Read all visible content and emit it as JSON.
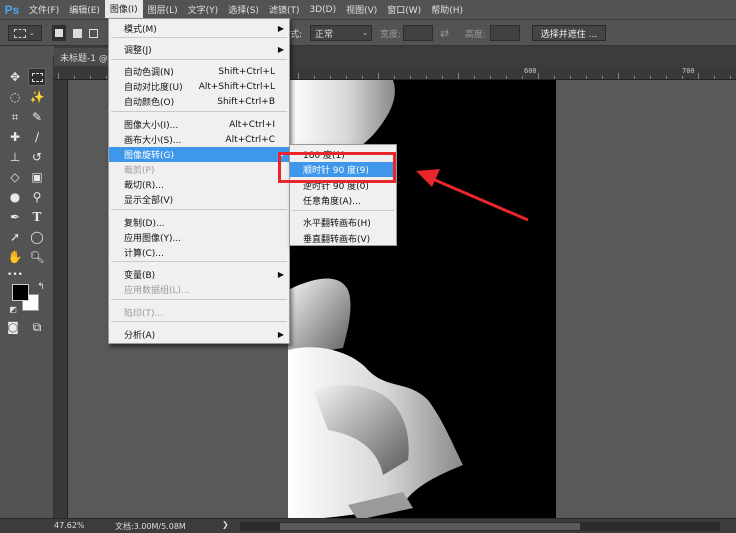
{
  "app": {
    "logo": "Ps"
  },
  "menubar": {
    "items": [
      {
        "label": "文件(F)",
        "active": false
      },
      {
        "label": "编辑(E)",
        "active": false
      },
      {
        "label": "图像(I)",
        "active": true
      },
      {
        "label": "图层(L)",
        "active": false
      },
      {
        "label": "文字(Y)",
        "active": false
      },
      {
        "label": "选择(S)",
        "active": false
      },
      {
        "label": "滤镜(T)",
        "active": false
      },
      {
        "label": "3D(D)",
        "active": false
      },
      {
        "label": "视图(V)",
        "active": false
      },
      {
        "label": "窗口(W)",
        "active": false
      },
      {
        "label": "帮助(H)",
        "active": false
      }
    ]
  },
  "options_bar": {
    "style_label": "式:",
    "style_value": "正常",
    "width_label": "宽度:",
    "height_label": "高度:",
    "select_mask_button": "选择并遮住 ..."
  },
  "document": {
    "tab_title": "未标题-1 @"
  },
  "ruler": {
    "labels": [
      "600",
      "700"
    ]
  },
  "status": {
    "zoom": "47.62%",
    "doc_info": "文档:3.00M/5.08M"
  },
  "image_menu": {
    "items": [
      {
        "label": "模式(M)",
        "shortcut": "",
        "submenu": true,
        "disabled": false,
        "highlighted": false
      },
      {
        "label": "调整(J)",
        "shortcut": "",
        "submenu": true,
        "disabled": false,
        "highlighted": false
      },
      {
        "label": "自动色调(N)",
        "shortcut": "Shift+Ctrl+L",
        "submenu": false,
        "disabled": false,
        "highlighted": false
      },
      {
        "label": "自动对比度(U)",
        "shortcut": "Alt+Shift+Ctrl+L",
        "submenu": false,
        "disabled": false,
        "highlighted": false
      },
      {
        "label": "自动颜色(O)",
        "shortcut": "Shift+Ctrl+B",
        "submenu": false,
        "disabled": false,
        "highlighted": false
      },
      {
        "label": "图像大小(I)...",
        "shortcut": "Alt+Ctrl+I",
        "submenu": false,
        "disabled": false,
        "highlighted": false
      },
      {
        "label": "画布大小(S)...",
        "shortcut": "Alt+Ctrl+C",
        "submenu": false,
        "disabled": false,
        "highlighted": false
      },
      {
        "label": "图像旋转(G)",
        "shortcut": "",
        "submenu": true,
        "disabled": false,
        "highlighted": true
      },
      {
        "label": "裁剪(P)",
        "shortcut": "",
        "submenu": false,
        "disabled": true,
        "highlighted": false
      },
      {
        "label": "裁切(R)...",
        "shortcut": "",
        "submenu": false,
        "disabled": false,
        "highlighted": false
      },
      {
        "label": "显示全部(V)",
        "shortcut": "",
        "submenu": false,
        "disabled": false,
        "highlighted": false
      },
      {
        "label": "复制(D)...",
        "shortcut": "",
        "submenu": false,
        "disabled": false,
        "highlighted": false
      },
      {
        "label": "应用图像(Y)...",
        "shortcut": "",
        "submenu": false,
        "disabled": false,
        "highlighted": false
      },
      {
        "label": "计算(C)...",
        "shortcut": "",
        "submenu": false,
        "disabled": false,
        "highlighted": false
      },
      {
        "label": "变量(B)",
        "shortcut": "",
        "submenu": true,
        "disabled": false,
        "highlighted": false
      },
      {
        "label": "应用数据组(L)...",
        "shortcut": "",
        "submenu": false,
        "disabled": true,
        "highlighted": false
      },
      {
        "label": "陷印(T)...",
        "shortcut": "",
        "submenu": false,
        "disabled": true,
        "highlighted": false
      },
      {
        "label": "分析(A)",
        "shortcut": "",
        "submenu": true,
        "disabled": false,
        "highlighted": false
      }
    ]
  },
  "rotate_menu": {
    "items": [
      {
        "label": "180 度(1)",
        "highlighted": false
      },
      {
        "label": "顺时针 90 度(9)",
        "highlighted": true
      },
      {
        "label": "逆时针 90 度(0)",
        "highlighted": false
      },
      {
        "label": "任意角度(A)...",
        "highlighted": false
      },
      {
        "label": "水平翻转画布(H)",
        "highlighted": false
      },
      {
        "label": "垂直翻转画布(V)",
        "highlighted": false
      }
    ]
  },
  "colors": {
    "accent": "#3e97ea",
    "annotation": "#e8262c"
  }
}
